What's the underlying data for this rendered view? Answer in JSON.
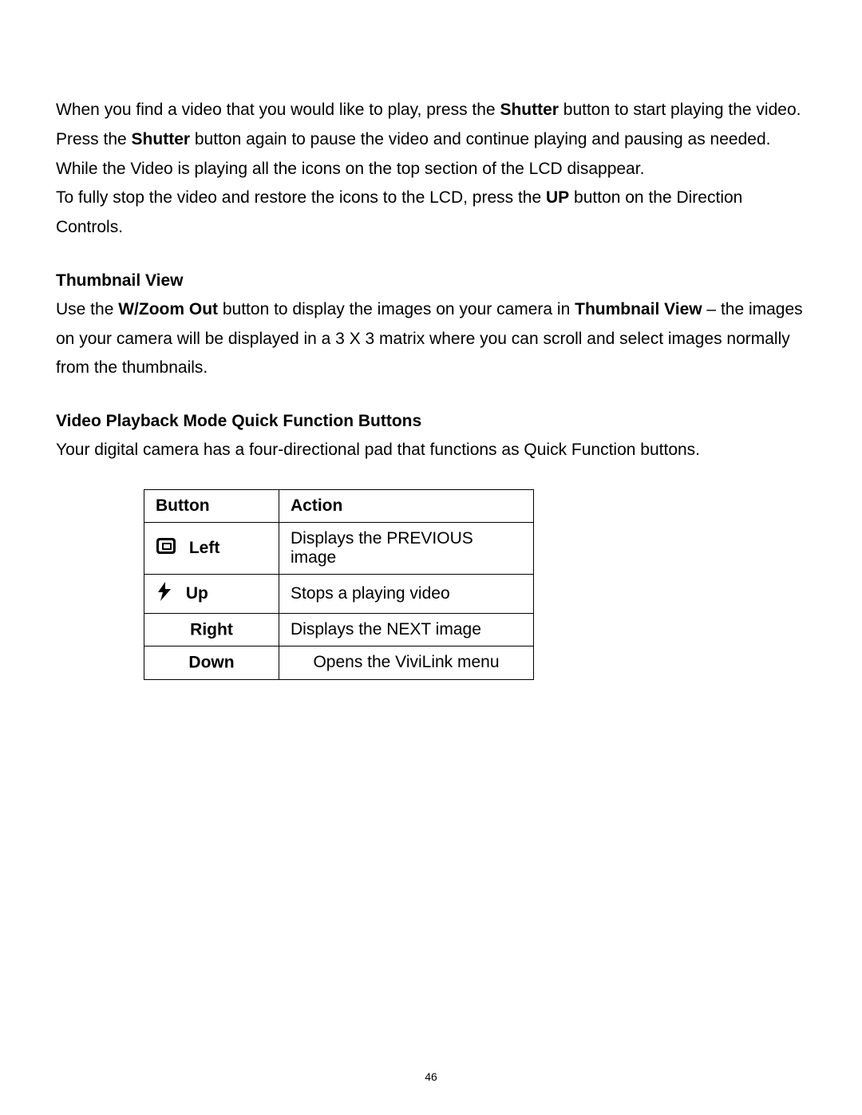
{
  "para1": {
    "a": "When you find a video that you would like to play, press the ",
    "b": "Shutter",
    "c": " button to start playing the video."
  },
  "para2": {
    "a": "Press the ",
    "b": "Shutter",
    "c": " button again to pause the video and continue playing and pausing as needed."
  },
  "para3": "While the Video is playing all the icons on the top section of the LCD disappear.",
  "para4": {
    "a": "To fully stop the video and restore the icons to the LCD, press the ",
    "b": "UP",
    "c": " button on the Direction Controls."
  },
  "thumb": {
    "heading": "Thumbnail View",
    "a": "Use the ",
    "b": "W/Zoom Out",
    "c": " button to display the images on your camera in ",
    "d": "Thumbnail View",
    "e": " – the images on your camera will be displayed in a 3 X 3 matrix where you can scroll and select images normally from the thumbnails."
  },
  "quick": {
    "heading": "Video Playback Mode Quick Function Buttons",
    "intro": "Your digital camera has a four-directional pad that functions as Quick Function buttons."
  },
  "table": {
    "h_button": "Button",
    "h_action": "Action",
    "left": {
      "label": "Left",
      "action": "Displays the PREVIOUS image"
    },
    "up": {
      "label": "Up",
      "action": "Stops a playing video"
    },
    "right": {
      "label": "Right",
      "action": "Displays the NEXT image"
    },
    "down": {
      "label": "Down",
      "action": "Opens the ViviLink menu"
    }
  },
  "page_number": "46"
}
